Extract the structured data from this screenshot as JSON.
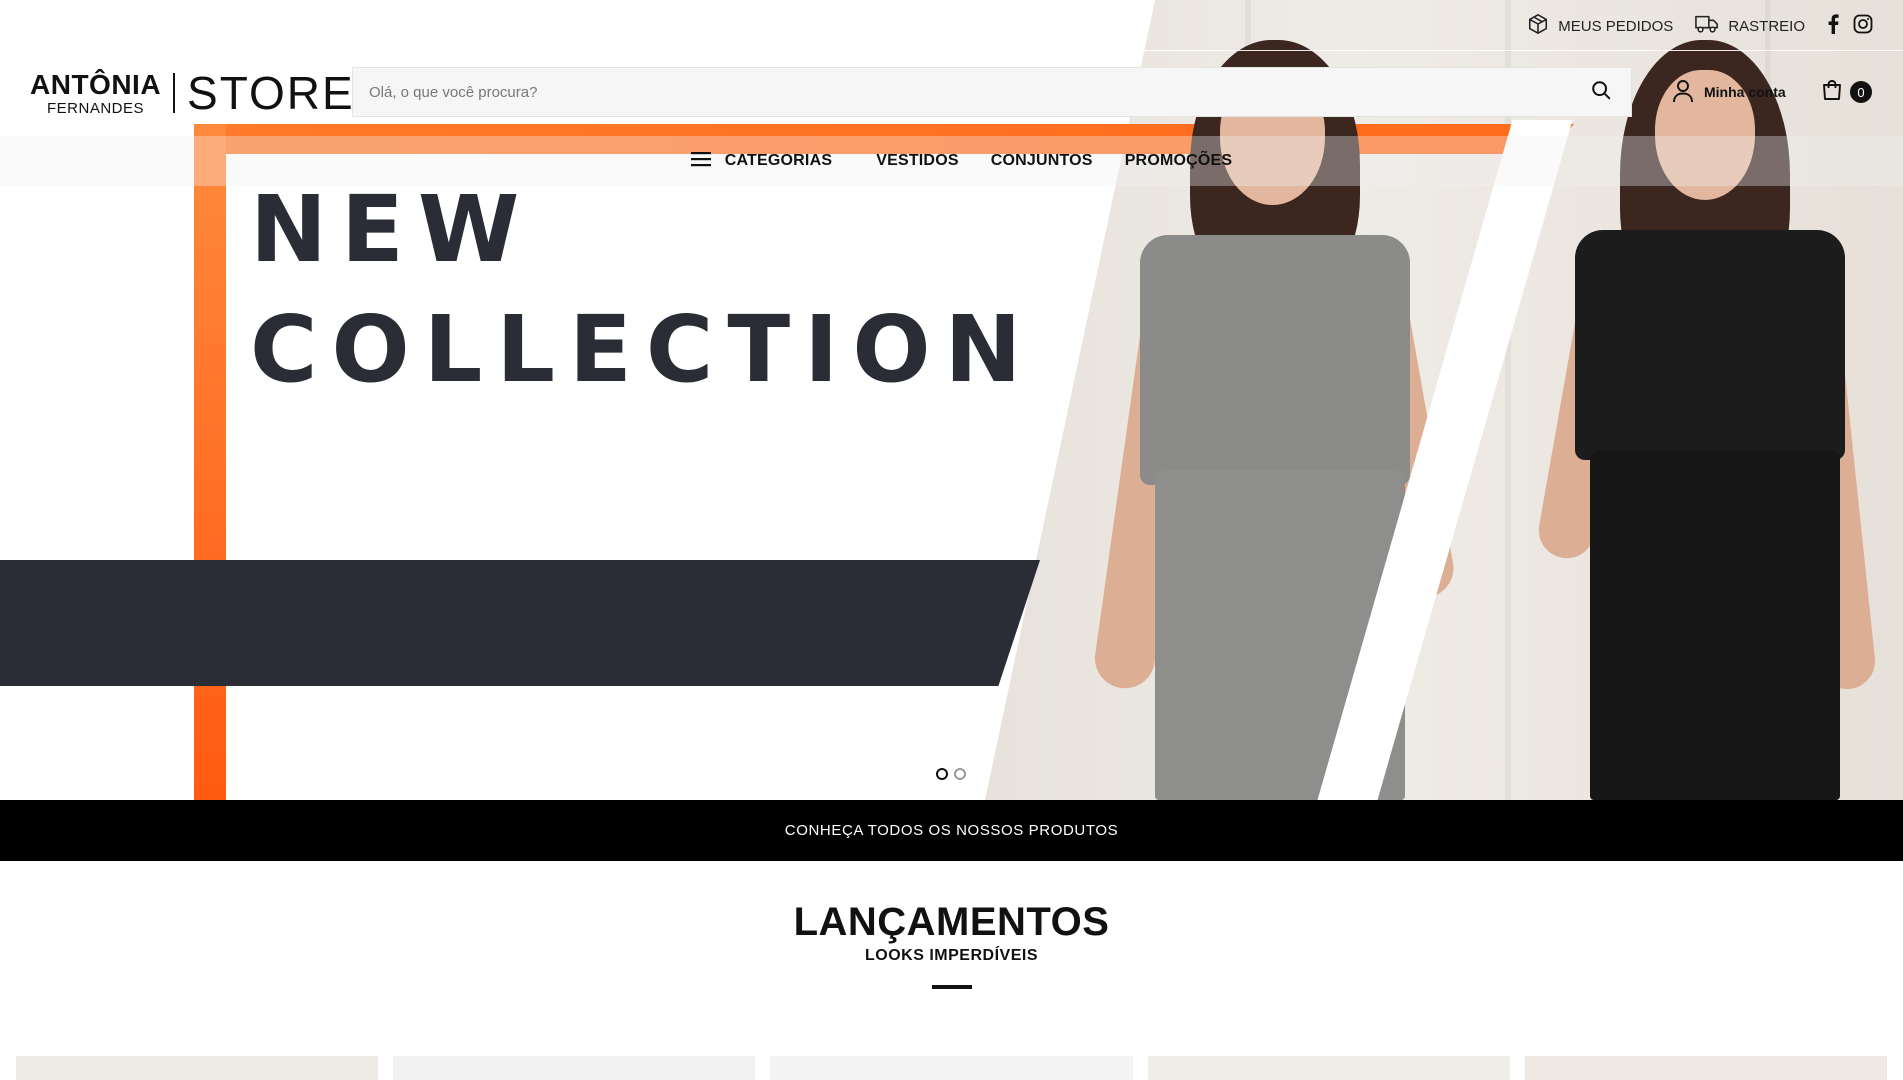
{
  "topbar": {
    "orders_label": "MEUS PEDIDOS",
    "orders_icon": "box-icon",
    "tracking_label": "RASTREIO",
    "tracking_icon": "truck-icon",
    "facebook_icon": "facebook-icon",
    "instagram_icon": "instagram-icon"
  },
  "logo": {
    "brand_line1": "ANTÔNIA",
    "brand_line2": "FERNANDES",
    "brand_store": "STORE"
  },
  "search": {
    "placeholder": "Olá, o que você procura?",
    "value": "",
    "icon": "search-icon"
  },
  "account": {
    "label": "Minha conta",
    "icon": "user-icon"
  },
  "cart": {
    "icon": "cart-icon",
    "count": "0"
  },
  "menu": {
    "categories_label": "CATEGORIAS",
    "categories_icon": "hamburger-icon",
    "items": [
      "VESTIDOS",
      "CONJUNTOS",
      "PROMOÇÕES"
    ]
  },
  "hero": {
    "headline_line1": "NEW",
    "headline_line2": "COLLECTION",
    "slide_count": 2,
    "active_slide": 1,
    "accent_color": "#ff6a1c",
    "dark_color": "#2a2c36"
  },
  "cta": {
    "label": "CONHEÇA TODOS OS NOSSOS PRODUTOS"
  },
  "section": {
    "title": "LANÇAMENTOS",
    "subtitle": "LOOKS IMPERDÍVEIS"
  }
}
